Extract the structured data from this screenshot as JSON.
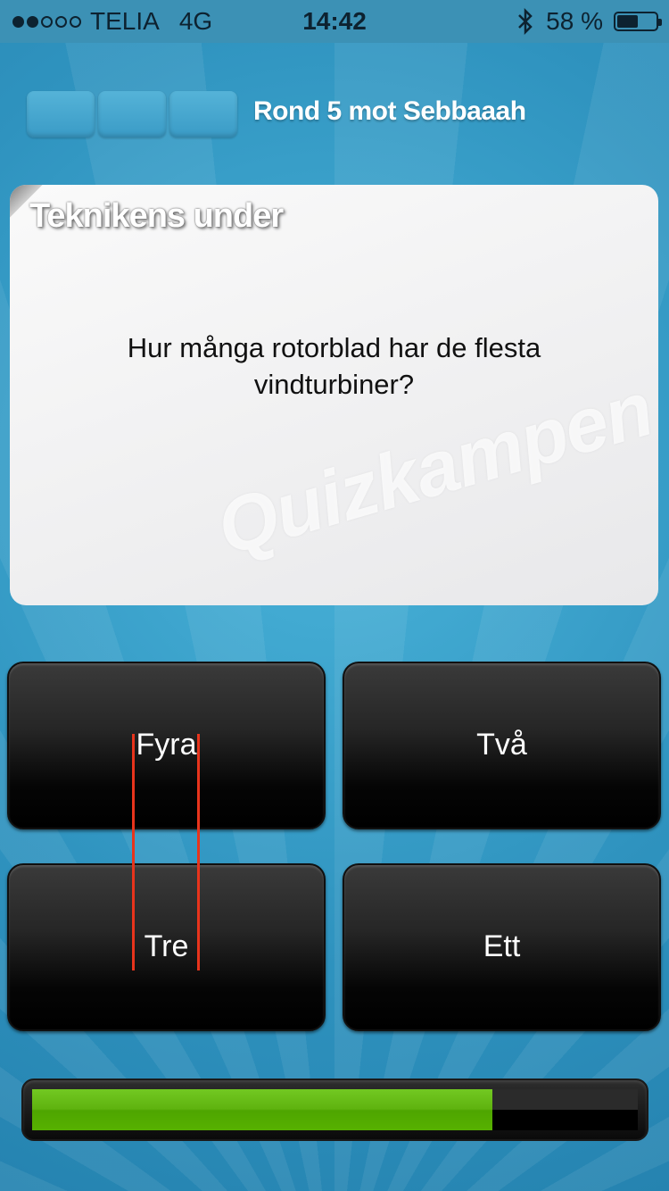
{
  "status_bar": {
    "signal_filled": 2,
    "signal_total": 5,
    "carrier": "TELIA",
    "network": "4G",
    "time": "14:42",
    "bluetooth_icon": "bluetooth-icon",
    "battery_percent_text": "58 %",
    "battery_level": 0.58
  },
  "round": {
    "boxes": 3,
    "title": "Rond 5 mot Sebbaaah"
  },
  "question_card": {
    "category": "Teknikens under",
    "question": "Hur många rotorblad har de flesta vindturbiner?",
    "watermark": "Quizkampen"
  },
  "answers": [
    {
      "label": "Fyra"
    },
    {
      "label": "Två"
    },
    {
      "label": "Tre"
    },
    {
      "label": "Ett"
    }
  ],
  "timer": {
    "remaining_fraction": 0.76,
    "fill_color": "#5fb30f"
  },
  "colors": {
    "background": "#3aa2cc",
    "annotation_red": "#e8341c"
  }
}
